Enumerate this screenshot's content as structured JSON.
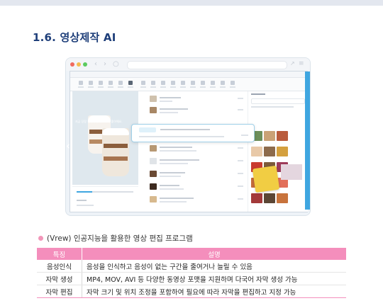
{
  "section_title": "1.6. 영상제작 AI",
  "colors": {
    "title": "#1f3f7a",
    "header_pink": "#f48ebc",
    "bullet": "#f296b9",
    "accent_blue": "#3fa6e0"
  },
  "screenshot": {
    "preview_overlay_text": "지금 당장 등록하세요, 모두가 좋아해요.",
    "icons": [
      "back-arrow-icon",
      "forward-arrow-icon",
      "reload-icon",
      "expand-icon",
      "menu-icon"
    ]
  },
  "bullet": "(Vrew) 인공지능을 활용한 영상 편집 프로그램",
  "table": {
    "headers": [
      "특징",
      "설명"
    ],
    "rows": [
      {
        "feature": "음성인식",
        "desc": "음성을 인식하고 음성이 없는 구간을 줄여거나 늘릴 수 있음"
      },
      {
        "feature": "자막 생성",
        "desc": "MP4, MOV, AVI 등 다양한 동영상 포맷을 지원하며 다국어 자막 생성 가능"
      },
      {
        "feature": "자막 편집",
        "desc": "자막 크기 및 위치 조정을 포함하여 필요에 따라 자막을 편집하고 지정 가능"
      }
    ]
  }
}
